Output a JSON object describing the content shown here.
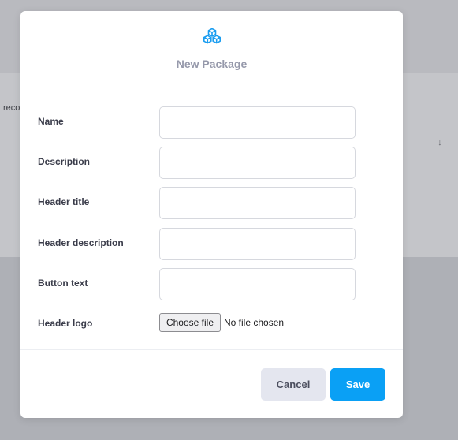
{
  "background": {
    "partial_text": "reco",
    "arrow_glyph": "↓"
  },
  "modal": {
    "icon": "cubes-icon",
    "title": "New Package",
    "fields": [
      {
        "label": "Name",
        "value": ""
      },
      {
        "label": "Description",
        "value": ""
      },
      {
        "label": "Header title",
        "value": ""
      },
      {
        "label": "Header description",
        "value": ""
      },
      {
        "label": "Button text",
        "value": ""
      }
    ],
    "file_field": {
      "label": "Header logo",
      "button_label": "Choose file",
      "status": "No file chosen"
    },
    "cancel_label": "Cancel",
    "save_label": "Save"
  },
  "colors": {
    "accent": "#0aa0f5",
    "title": "#9699ab",
    "icon": "#1a9df0"
  }
}
